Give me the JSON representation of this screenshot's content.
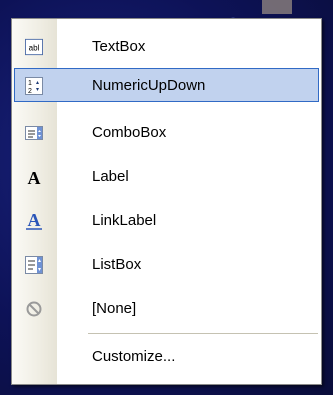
{
  "menu": {
    "items": [
      {
        "label": "TextBox",
        "icon": "textbox-icon"
      },
      {
        "label": "NumericUpDown",
        "icon": "numeric-updown-icon",
        "selected": true
      },
      {
        "label": "ComboBox",
        "icon": "combobox-icon"
      },
      {
        "label": "Label",
        "icon": "label-icon"
      },
      {
        "label": "LinkLabel",
        "icon": "linklabel-icon"
      },
      {
        "label": "ListBox",
        "icon": "listbox-icon"
      },
      {
        "label": "[None]",
        "icon": "none-icon"
      }
    ],
    "customize": {
      "label": "Customize...",
      "icon": ""
    }
  },
  "colors": {
    "selection_bg": "#c1d2ee",
    "selection_border": "#316ac5",
    "background": "#0d1257"
  }
}
